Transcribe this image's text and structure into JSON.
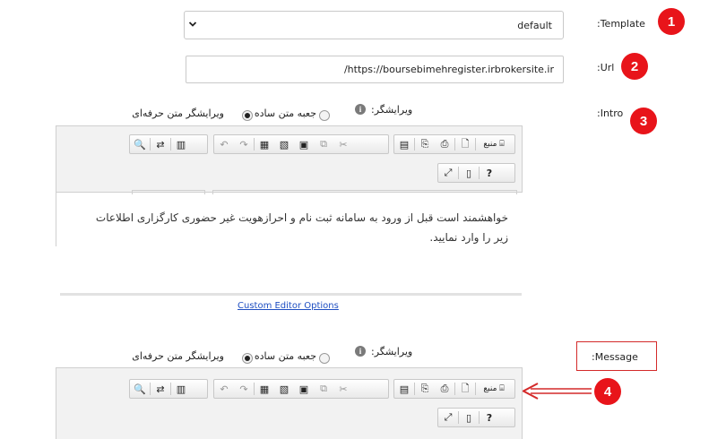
{
  "template": {
    "label": ":Template",
    "value": "default",
    "badge": "1"
  },
  "url": {
    "label": ":Url",
    "value": "/https://boursebimehregister.irbrokersite.ir",
    "badge": "2"
  },
  "intro": {
    "label": ":Intro",
    "badge": "3",
    "editor_label": "ویرایشگر:",
    "option_plain": "جعبه متن ساده",
    "option_rich": "ویرایشگر متن حرفه‌ای",
    "content": "خواهشمند است قبل از ورود به سامانه ثبت نام و احرازهویت غیر حضوری کارگزاری اطلاعات زیر را وارد نمایید.",
    "custom_options_link": "Custom Editor Options"
  },
  "message": {
    "label": ":Message",
    "badge": "4",
    "editor_label": "ویرایشگر:",
    "option_plain": "جعبه متن ساده",
    "option_rich": "ویرایشگر متن حرفه‌ای"
  },
  "toolbar": {
    "source_label": "منبع",
    "help_label": "?"
  },
  "colors": {
    "badge": "#e8141a",
    "link": "#1f4fc2",
    "arrow": "#d42a2a"
  }
}
